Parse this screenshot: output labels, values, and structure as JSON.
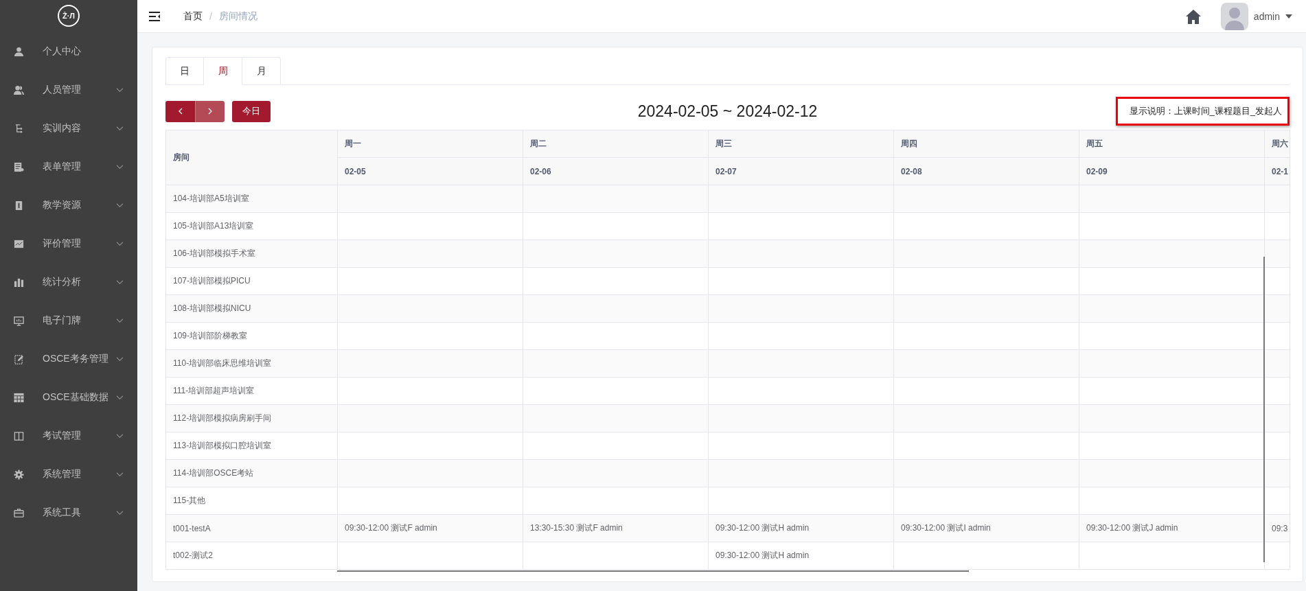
{
  "sidebar": {
    "logo": "Ż·Л",
    "items": [
      {
        "label": "个人中心",
        "kind": "link"
      },
      {
        "label": "人员管理",
        "kind": "menu"
      },
      {
        "label": "实训内容",
        "kind": "menu"
      },
      {
        "label": "表单管理",
        "kind": "menu"
      },
      {
        "label": "教学资源",
        "kind": "menu"
      },
      {
        "label": "评价管理",
        "kind": "menu"
      },
      {
        "label": "统计分析",
        "kind": "menu"
      },
      {
        "label": "电子门牌",
        "kind": "menu"
      },
      {
        "label": "OSCE考务管理",
        "kind": "menu"
      },
      {
        "label": "OSCE基础数据",
        "kind": "menu"
      },
      {
        "label": "考试管理",
        "kind": "menu"
      },
      {
        "label": "系统管理",
        "kind": "menu"
      },
      {
        "label": "系统工具",
        "kind": "menu"
      }
    ]
  },
  "header": {
    "breadcrumb": [
      "首页",
      "房间情况"
    ],
    "separator": "/",
    "user": "admin"
  },
  "tabs": [
    {
      "label": "日",
      "selected": false
    },
    {
      "label": "周",
      "selected": true
    },
    {
      "label": "月",
      "selected": false
    }
  ],
  "toolbar": {
    "today": "今日",
    "title": "2024-02-05 ~ 2024-02-12",
    "legend": "显示说明：上课时间_课程题目_发起人"
  },
  "table": {
    "corner": "房间",
    "columns": [
      {
        "day": "周一",
        "date": "02-05"
      },
      {
        "day": "周二",
        "date": "02-06"
      },
      {
        "day": "周三",
        "date": "02-07"
      },
      {
        "day": "周四",
        "date": "02-08"
      },
      {
        "day": "周五",
        "date": "02-09"
      },
      {
        "day": "周六",
        "date": "02-1"
      }
    ],
    "rows": [
      {
        "room": "104-培训部A5培训室",
        "cells": [
          null,
          null,
          null,
          null,
          null,
          null
        ]
      },
      {
        "room": "105-培训部A13培训室",
        "cells": [
          null,
          null,
          null,
          null,
          null,
          null
        ]
      },
      {
        "room": "106-培训部模拟手术室",
        "cells": [
          null,
          null,
          null,
          null,
          null,
          null
        ]
      },
      {
        "room": "107-培训部模拟PICU",
        "cells": [
          null,
          null,
          null,
          null,
          null,
          null
        ]
      },
      {
        "room": "108-培训部模拟NICU",
        "cells": [
          null,
          null,
          null,
          null,
          null,
          null
        ]
      },
      {
        "room": "109-培训部阶梯教室",
        "cells": [
          null,
          null,
          null,
          null,
          null,
          null
        ]
      },
      {
        "room": "110-培训部临床思维培训室",
        "cells": [
          null,
          null,
          null,
          null,
          null,
          null
        ]
      },
      {
        "room": "111-培训部超声培训室",
        "cells": [
          null,
          null,
          null,
          null,
          null,
          null
        ]
      },
      {
        "room": "112-培训部模拟病房刷手间",
        "cells": [
          null,
          null,
          null,
          null,
          null,
          null
        ]
      },
      {
        "room": "113-培训部模拟口腔培训室",
        "cells": [
          null,
          null,
          null,
          null,
          null,
          null
        ]
      },
      {
        "room": "114-培训部OSCE考站",
        "cells": [
          null,
          null,
          null,
          null,
          null,
          null
        ]
      },
      {
        "room": "115-其他",
        "cells": [
          null,
          null,
          null,
          null,
          null,
          null
        ]
      },
      {
        "room": "t001-testA",
        "cells": [
          "09:30-12:00 测试F admin",
          "13:30-15:30 测试F admin",
          "09:30-12:00 测试H admin",
          "09:30-12:00 测试I admin",
          "09:30-12:00 测试J admin",
          "09:3"
        ]
      },
      {
        "room": "t002-测试2",
        "cells": [
          null,
          null,
          "09:30-12:00 测试H admin",
          null,
          null,
          null
        ]
      }
    ]
  }
}
